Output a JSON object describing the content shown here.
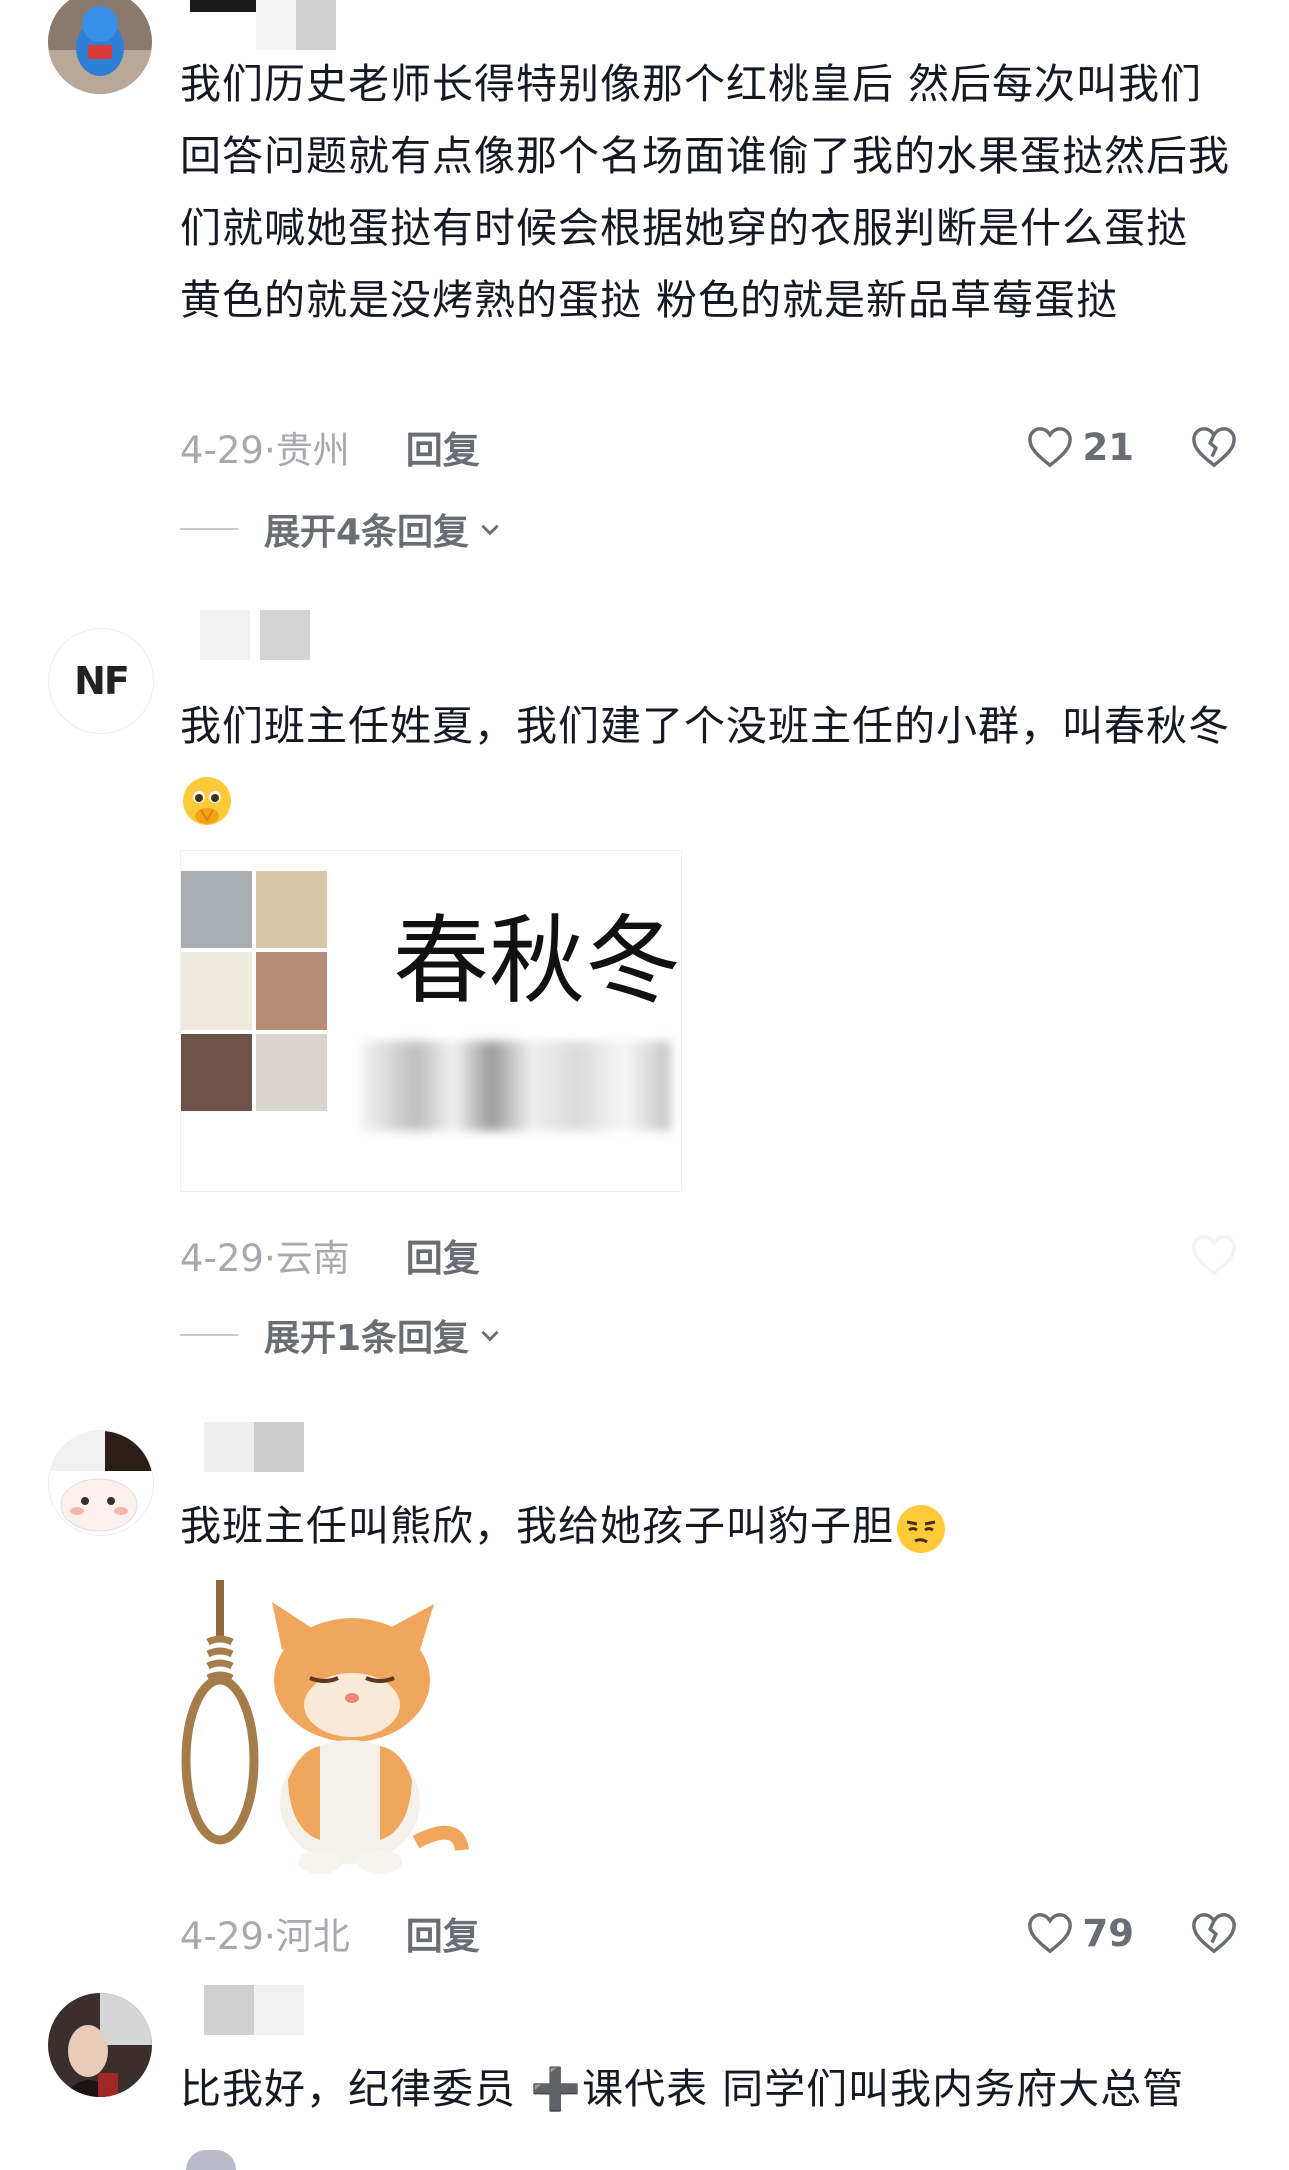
{
  "comments": [
    {
      "text": "我们历史老师长得特别像那个红桃皇后 然后每次叫我们回答问题就有点像那个名场面谁偷了我的水果蛋挞然后我们就喊她蛋挞有时候会根据她穿的衣服判断是什么蛋挞 黄色的就是没烤熟的蛋挞 粉色的就是新品草莓蛋挞",
      "date": "4-29·贵州",
      "reply": "回复",
      "likes": "21",
      "expand": "展开4条回复"
    },
    {
      "avatar_text": "NF",
      "text": "我们班主任姓夏，我们建了个没班主任的小群，叫春秋冬",
      "emoji": "pleading-hands-emoji",
      "group_name": "春秋冬",
      "date": "4-29·云南",
      "reply": "回复",
      "expand": "展开1条回复"
    },
    {
      "text": "我班主任叫熊欣，我给她孩子叫豹子胆",
      "emoji": "smirk-emoji",
      "date": "4-29·河北",
      "reply": "回复",
      "likes": "79"
    },
    {
      "text": "比我好，纪律委员 ➕课代表 同学们叫我内务府大总管"
    }
  ],
  "colors": {
    "text": "#161823",
    "meta": "#a7a9ae",
    "action": "#6b6d74"
  }
}
